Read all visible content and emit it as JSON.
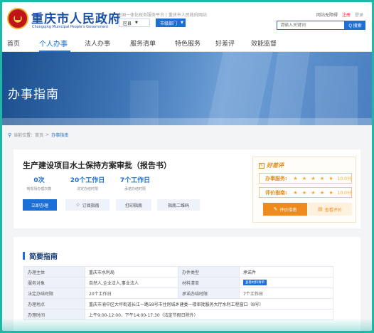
{
  "header": {
    "site_name": "重庆市人民政府",
    "site_name_en": "Chongqing Municipal People's Government",
    "slogan": "全国一体化政务服务平台 | 重庆市人民政府网站",
    "district_select": "区县",
    "dept_select": "市级部门",
    "links": {
      "accessibility": "网站无障碍",
      "register": "注册",
      "login": "登录"
    },
    "search": {
      "placeholder": "请输入关键词",
      "button": "Q 搜索"
    }
  },
  "nav": {
    "items": [
      "首页",
      "个人办事",
      "法人办事",
      "服务清单",
      "特色服务",
      "好差评",
      "效能监督"
    ],
    "active": "个人办事"
  },
  "banner": {
    "title": "办事指南"
  },
  "breadcrumb": {
    "prefix": "当前位置：",
    "home": "首页",
    "sep": ">",
    "current": "办事指南"
  },
  "service": {
    "title": "生产建设项目水土保持方案审批（报告书）",
    "stats": [
      {
        "value": "0次",
        "label": "到现场办理次数"
      },
      {
        "value": "20个工作日",
        "label": "法定办结时限"
      },
      {
        "value": "7个工作日",
        "label": "承诺办结时限"
      }
    ],
    "actions": {
      "apply": "立即办理",
      "subscribe": "订阅指南",
      "print": "打印指南",
      "qrcode": "指南二维码"
    }
  },
  "rating": {
    "head": "好差评",
    "rows": [
      {
        "label": "办事服务:",
        "stars": "★ ★ ★ ★ ★",
        "score": "10.0分",
        "value": 10.0
      },
      {
        "label": "评价指南:",
        "stars": "★ ★ ★ ★ ★",
        "score": "10.0分",
        "value": 10.0
      }
    ],
    "evaluate_button": "评价指南",
    "view_button": "查看评价"
  },
  "guide": {
    "title": "简要指南",
    "rows": [
      {
        "k1": "办理主体",
        "v1": "重庆市水利局",
        "k2": "办件类型",
        "v2": "承诺件"
      },
      {
        "k1": "服务对象",
        "v1": "自然人,企业法人,事业法人",
        "k2": "材料清单",
        "v2": "查看材料清单"
      },
      {
        "k1": "法定办结时限",
        "v1": "20个工作日",
        "k2": "承诺办结时限",
        "v2": "7个工作日"
      }
    ],
    "address_label": "办理地点",
    "address": "重庆市渝中区大坪街道长江一路58号市住房城乡建委一楼审批服务大厅水利工程窗口（8号）",
    "time_label": "办理时间",
    "time": "上午9:00-12:00，下午14:00-17:30（法定节假日除外）"
  },
  "colors": {
    "accent": "#1d6fd8",
    "rating": "#f08a1d",
    "frame": "#1fb7a6"
  }
}
